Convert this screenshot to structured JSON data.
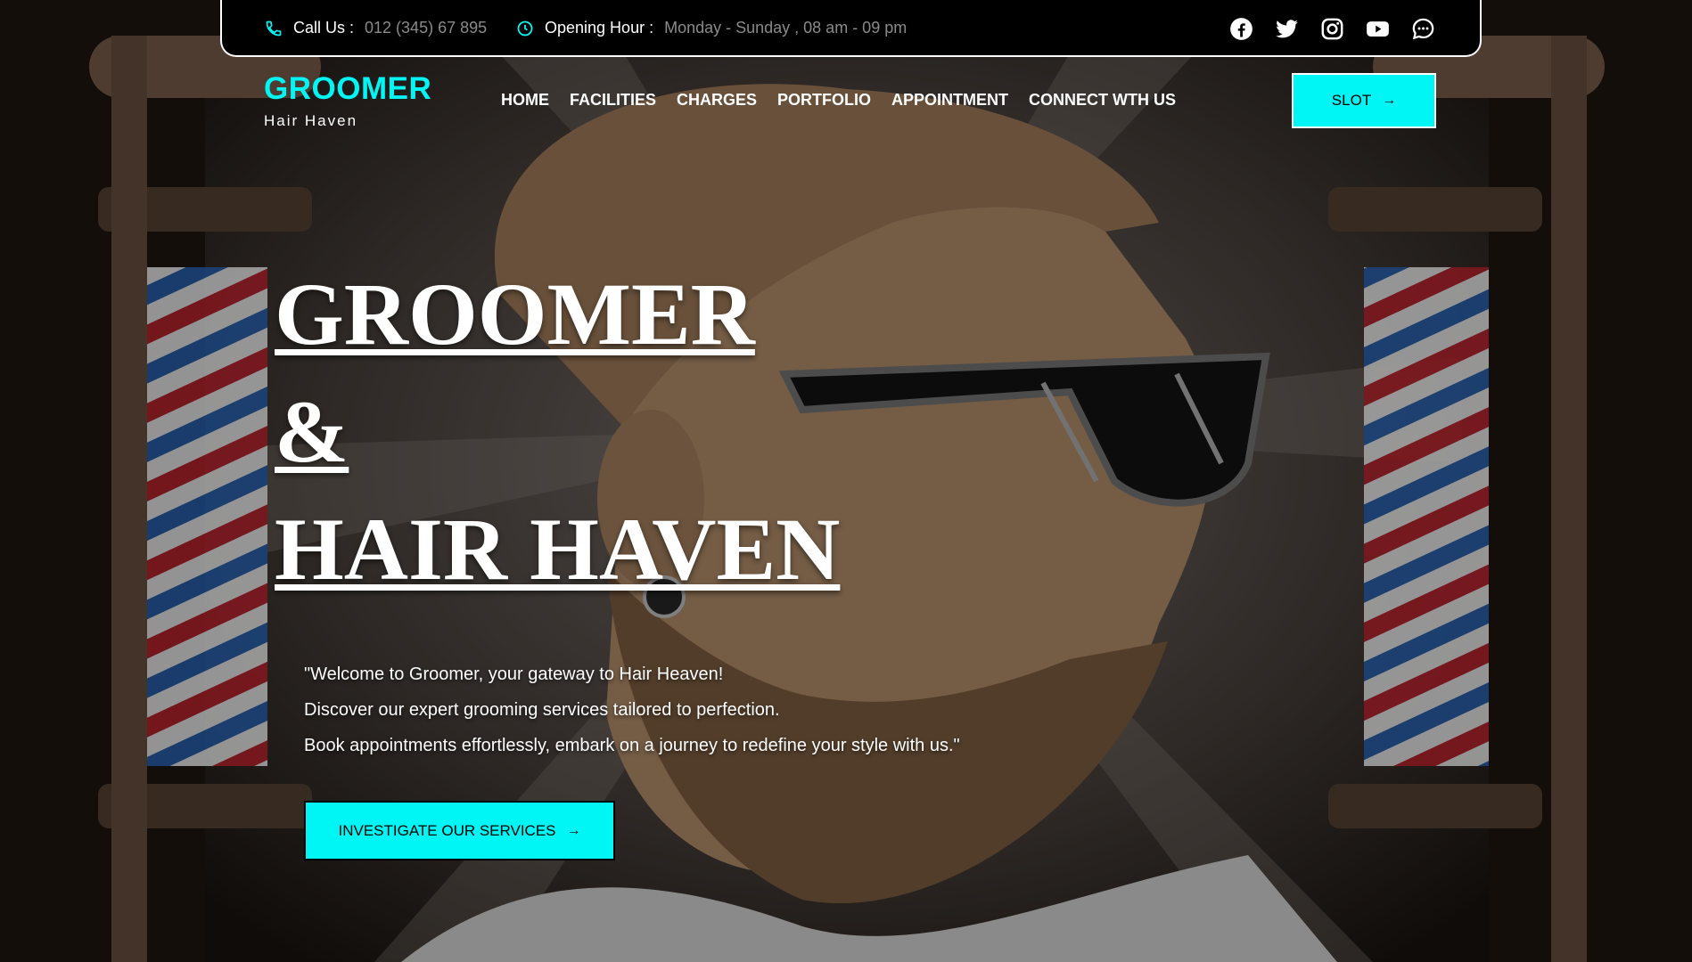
{
  "topbar": {
    "call_label": "Call Us :",
    "call_value": "012 (345) 67 895",
    "hours_label": "Opening Hour :",
    "hours_value": "Monday - Sunday , 08 am - 09 pm",
    "socials": [
      "facebook-icon",
      "twitter-icon",
      "instagram-icon",
      "youtube-icon",
      "chat-icon"
    ]
  },
  "logo": {
    "title": "GROOMER",
    "subtitle": "Hair Haven"
  },
  "nav": {
    "items": [
      "HOME",
      "FACILITIES",
      "CHARGES",
      "PORTFOLIO",
      "APPOINTMENT",
      "CONNECT WTH US"
    ]
  },
  "slot_button": {
    "label": "SLOT",
    "icon": "arrow-right-icon"
  },
  "hero": {
    "title_line1": "GROOMER",
    "title_line2": "&",
    "title_line3": "HAIR HAVEN",
    "text_line1": "\"Welcome to Groomer, your gateway to Hair Heaven!",
    "text_line2": "Discover our expert grooming services tailored to perfection.",
    "text_line3": "Book appointments effortlessly, embark on a journey to redefine your style with us.\"",
    "cta_label": "INVESTIGATE OUR SERVICES"
  },
  "colors": {
    "accent": "#00f5f5",
    "topbar_bg": "#000000",
    "text": "#ffffff"
  }
}
